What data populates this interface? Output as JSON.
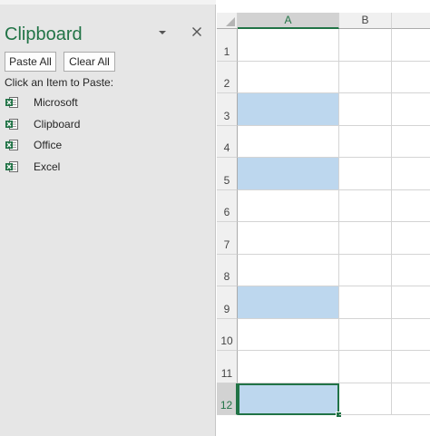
{
  "pane": {
    "title": "Clipboard",
    "paste_all_label": "Paste All",
    "clear_all_label": "Clear All",
    "instruction": "Click an Item to Paste:",
    "options_icon": "dropdown-arrow-icon",
    "close_icon": "close-icon",
    "items": [
      {
        "label": "Microsoft",
        "icon": "excel-clip-icon"
      },
      {
        "label": "Clipboard",
        "icon": "excel-clip-icon"
      },
      {
        "label": "Office",
        "icon": "excel-clip-icon"
      },
      {
        "label": "Excel",
        "icon": "excel-clip-icon"
      }
    ]
  },
  "sheet": {
    "columns": [
      "A",
      "B",
      ""
    ],
    "active_column": "A",
    "rows": [
      "1",
      "2",
      "3",
      "4",
      "5",
      "6",
      "7",
      "8",
      "9",
      "10",
      "11",
      "12"
    ],
    "active_row": "12",
    "highlighted_rows": [
      "3",
      "5",
      "9",
      "12"
    ],
    "selected_cell": "A12"
  },
  "colors": {
    "accent_green": "#217346",
    "highlight_blue": "#bdd7ee",
    "pane_background": "#e6e6e6"
  }
}
